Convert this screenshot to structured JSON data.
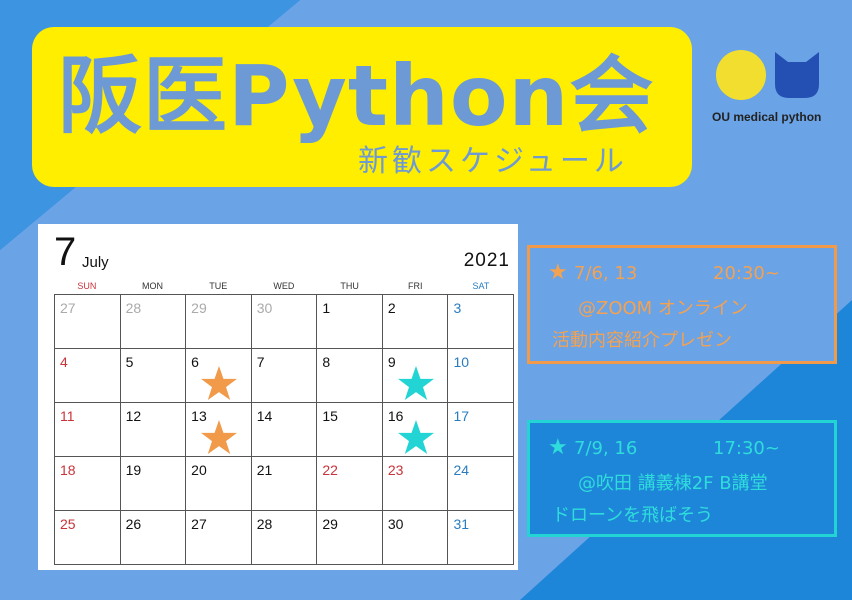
{
  "title": {
    "main": "阪医Python会",
    "sub": "新歓スケジュール"
  },
  "logo": {
    "text": "OU medical python"
  },
  "calendar": {
    "month_number": "7",
    "month_name": "July",
    "year": "2021",
    "weekdays": [
      "SUN",
      "MON",
      "TUE",
      "WED",
      "THU",
      "FRI",
      "SAT"
    ],
    "weeks": [
      [
        {
          "d": "27",
          "t": "muted"
        },
        {
          "d": "28",
          "t": "muted"
        },
        {
          "d": "29",
          "t": "muted"
        },
        {
          "d": "30",
          "t": "muted"
        },
        {
          "d": "1",
          "t": ""
        },
        {
          "d": "2",
          "t": ""
        },
        {
          "d": "3",
          "t": "sat"
        }
      ],
      [
        {
          "d": "4",
          "t": "sun"
        },
        {
          "d": "5",
          "t": ""
        },
        {
          "d": "6",
          "t": "",
          "star": "orange"
        },
        {
          "d": "7",
          "t": ""
        },
        {
          "d": "8",
          "t": ""
        },
        {
          "d": "9",
          "t": "",
          "star": "cyan"
        },
        {
          "d": "10",
          "t": "sat"
        }
      ],
      [
        {
          "d": "11",
          "t": "sun"
        },
        {
          "d": "12",
          "t": ""
        },
        {
          "d": "13",
          "t": "",
          "star": "orange"
        },
        {
          "d": "14",
          "t": ""
        },
        {
          "d": "15",
          "t": ""
        },
        {
          "d": "16",
          "t": "",
          "star": "cyan"
        },
        {
          "d": "17",
          "t": "sat"
        }
      ],
      [
        {
          "d": "18",
          "t": "sun"
        },
        {
          "d": "19",
          "t": ""
        },
        {
          "d": "20",
          "t": ""
        },
        {
          "d": "21",
          "t": ""
        },
        {
          "d": "22",
          "t": "sun"
        },
        {
          "d": "23",
          "t": "sun"
        },
        {
          "d": "24",
          "t": "sat"
        }
      ],
      [
        {
          "d": "25",
          "t": "sun"
        },
        {
          "d": "26",
          "t": ""
        },
        {
          "d": "27",
          "t": ""
        },
        {
          "d": "28",
          "t": ""
        },
        {
          "d": "29",
          "t": ""
        },
        {
          "d": "30",
          "t": ""
        },
        {
          "d": "31",
          "t": "sat"
        }
      ]
    ]
  },
  "events": [
    {
      "star": "★",
      "dates": "7/6, 13",
      "time": "20:30~",
      "place": "@ZOOM オンライン",
      "desc": "活動内容紹介プレゼン"
    },
    {
      "star": "★",
      "dates": "7/9, 16",
      "time": "17:30~",
      "place": "@吹田 講義棟2F B講堂",
      "desc": "ドローンを飛ばそう"
    }
  ],
  "colors": {
    "background_dark": "#1e86d8",
    "background_light": "#6aa3e6",
    "title_box": "#ffee00",
    "title_text": "#6d9ad4",
    "star_orange": "#f09a4a",
    "star_cyan": "#22d4d4"
  }
}
